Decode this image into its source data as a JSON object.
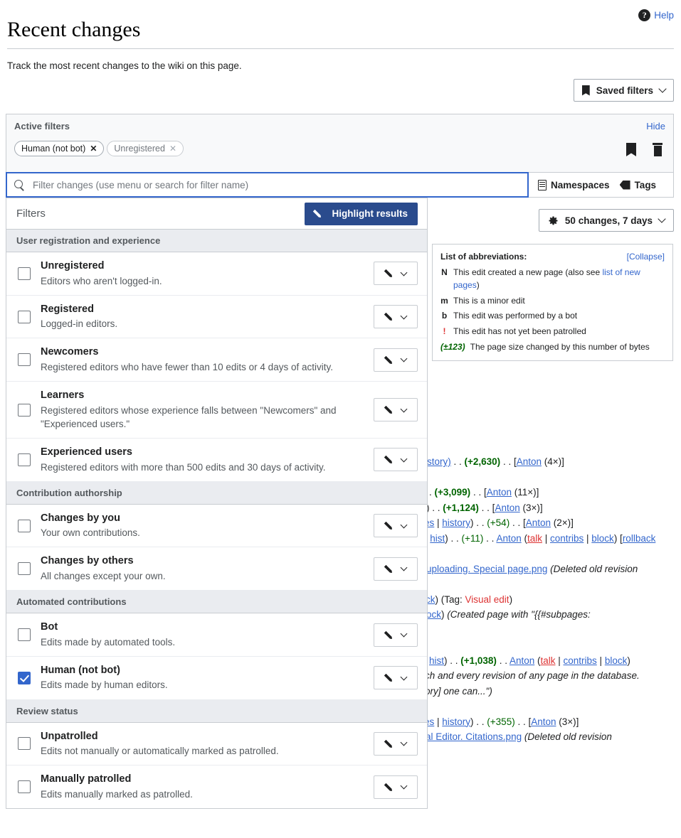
{
  "header": {
    "title": "Recent changes",
    "subtitle": "Track the most recent changes to the wiki on this page.",
    "help_label": "Help",
    "help_icon": "question-mark-circle-icon",
    "saved_filters_label": "Saved filters",
    "saved_filters_icon": "bookmark-icon"
  },
  "active_filters": {
    "title": "Active filters",
    "hide_label": "Hide",
    "tags": [
      {
        "label": "Human (not bot)",
        "remove": "✕",
        "active": true
      },
      {
        "label": "Unregistered",
        "remove": "✕",
        "active": false
      }
    ],
    "save_icon": "bookmark-icon",
    "clear_icon": "trash-icon"
  },
  "search": {
    "placeholder": "Filter changes (use menu or search for filter name)",
    "value": "",
    "search_icon": "search-icon",
    "namespaces_label": "Namespaces",
    "namespaces_icon": "namespace-icon",
    "tags_label": "Tags",
    "tags_icon": "tag-icon"
  },
  "filters_panel": {
    "title": "Filters",
    "highlight_label": "Highlight results",
    "highlight_icon": "pencil-icon",
    "groups": [
      {
        "name": "User registration and experience",
        "items": [
          {
            "label": "Unregistered",
            "desc": "Editors who aren't logged-in.",
            "checked": false
          },
          {
            "label": "Registered",
            "desc": "Logged-in editors.",
            "checked": false
          },
          {
            "label": "Newcomers",
            "desc": "Registered editors who have fewer than 10 edits or 4 days of activity.",
            "checked": false
          },
          {
            "label": "Learners",
            "desc": "Registered editors whose experience falls between \"Newcomers\" and \"Experienced users.\"",
            "checked": false
          },
          {
            "label": "Experienced users",
            "desc": "Registered editors with more than 500 edits and 30 days of activity.",
            "checked": false
          }
        ]
      },
      {
        "name": "Contribution authorship",
        "items": [
          {
            "label": "Changes by you",
            "desc": "Your own contributions.",
            "checked": false
          },
          {
            "label": "Changes by others",
            "desc": "All changes except your own.",
            "checked": false
          }
        ]
      },
      {
        "name": "Automated contributions",
        "items": [
          {
            "label": "Bot",
            "desc": "Edits made by automated tools.",
            "checked": false
          },
          {
            "label": "Human (not bot)",
            "desc": "Edits made by human editors.",
            "checked": true
          }
        ]
      },
      {
        "name": "Review status",
        "items": [
          {
            "label": "Unpatrolled",
            "desc": "Edits not manually or automatically marked as patrolled.",
            "checked": false
          },
          {
            "label": "Manually patrolled",
            "desc": "Edits manually marked as patrolled.",
            "checked": false
          }
        ]
      }
    ]
  },
  "results_controls": {
    "changes_label": "50 changes, 7 days",
    "gear_icon": "gear-icon"
  },
  "abbreviations": {
    "title": "List of abbreviations:",
    "collapse_label": "[Collapse]",
    "rows": [
      {
        "key": "N",
        "text": "This edit created a new page (also see ",
        "link": "list of new pages",
        "tail": ")"
      },
      {
        "key": "m",
        "text": "This is a minor edit",
        "link": "",
        "tail": ""
      },
      {
        "key": "b",
        "text": "This edit was performed by a bot",
        "link": "",
        "tail": ""
      },
      {
        "key": "!",
        "text": "This edit has not yet been patrolled",
        "link": "",
        "tail": ""
      },
      {
        "key": "(±123)",
        "text": "The page size changed by this number of bytes",
        "link": "",
        "tail": ""
      }
    ]
  },
  "changes_list": {
    "lines": [
      "story) . . (+2,630) . . [Anton (4×)]",
      "",
      ". (+3,099) . . [Anton (11×)]",
      ") . . (+1,124) . . [Anton (3×)]",
      "es | history) . . (+54) . . [Anton (2×)]",
      "| hist) . . (+11) . . Anton (talk | contribs | block) [rollback",
      "",
      "uploading. Special page.png (Deleted old revision",
      "",
      "ck) (Tag: Visual edit)",
      "lock) (Created page with \"{{#subpages:",
      "",
      "",
      "hist) . . (+1,038) . . Anton (talk | contribs | block)",
      "ch and every revision of any page in the database.",
      "ory] one can...\")",
      "",
      "es | history) . . (+355) . . [Anton (3×)]",
      "al Editor. Citations.png (Deleted old revision"
    ]
  }
}
